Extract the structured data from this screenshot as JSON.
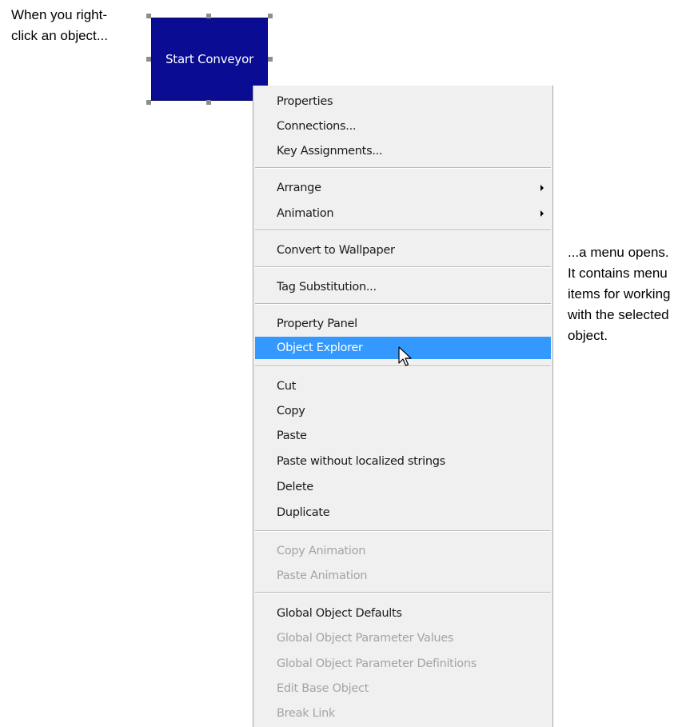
{
  "caption_left": [
    "When you right-",
    "click an object..."
  ],
  "caption_right": [
    "...a menu opens.",
    "It contains menu",
    "items for working",
    "with the selected",
    "object."
  ],
  "selected_object": {
    "label": "Start Conveyor",
    "fill_color": "#0a0c93"
  },
  "menu": {
    "highlight_color": "#3399ff",
    "items": [
      {
        "label": "Properties",
        "enabled": true
      },
      {
        "label": "Connections...",
        "enabled": true
      },
      {
        "label": "Key Assignments...",
        "enabled": true
      },
      {
        "label": "Arrange",
        "enabled": true,
        "submenu": true
      },
      {
        "label": "Animation",
        "enabled": true,
        "submenu": true
      },
      {
        "label": "Convert to Wallpaper",
        "enabled": true
      },
      {
        "label": "Tag Substitution...",
        "enabled": true
      },
      {
        "label": "Property Panel",
        "enabled": true
      },
      {
        "label": "Object Explorer",
        "enabled": true,
        "highlighted": true
      },
      {
        "label": "Cut",
        "enabled": true
      },
      {
        "label": "Copy",
        "enabled": true
      },
      {
        "label": "Paste",
        "enabled": true
      },
      {
        "label": "Paste without localized strings",
        "enabled": true
      },
      {
        "label": "Delete",
        "enabled": true
      },
      {
        "label": "Duplicate",
        "enabled": true
      },
      {
        "label": "Copy Animation",
        "enabled": false
      },
      {
        "label": "Paste Animation",
        "enabled": false
      },
      {
        "label": "Global Object Defaults",
        "enabled": true
      },
      {
        "label": "Global Object Parameter Values",
        "enabled": false
      },
      {
        "label": "Global Object Parameter Definitions",
        "enabled": false
      },
      {
        "label": "Edit Base Object",
        "enabled": false
      },
      {
        "label": "Break Link",
        "enabled": false
      }
    ]
  }
}
